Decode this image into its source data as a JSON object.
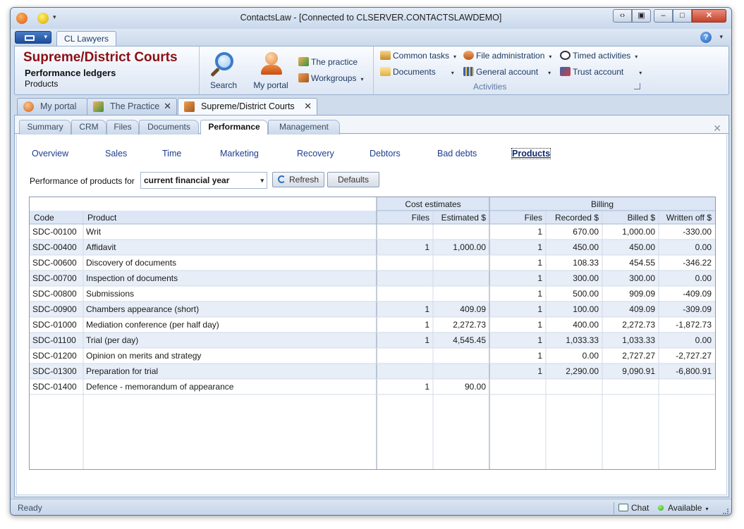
{
  "window": {
    "title": "ContactsLaw - [Connected to CLSERVER.CONTACTSLAWDEMO]",
    "ribbon_tab": "CL Lawyers"
  },
  "ribbon": {
    "context_title": "Supreme/District Courts",
    "context_subtitle": "Performance ledgers",
    "context_page": "Products",
    "search_label": "Search",
    "my_portal_label": "My portal",
    "the_practice_label": "The practice",
    "workgroups_label": "Workgroups",
    "common_tasks_label": "Common tasks",
    "documents_label": "Documents",
    "file_admin_label": "File administration",
    "general_account_label": "General account",
    "timed_activities_label": "Timed activities",
    "trust_account_label": "Trust account",
    "activities_group_label": "Activities"
  },
  "doc_tabs": [
    {
      "label": "My portal"
    },
    {
      "label": "The Practice"
    },
    {
      "label": "Supreme/District Courts"
    }
  ],
  "sub_tabs": [
    "Summary",
    "CRM",
    "Files",
    "Documents",
    "Performance",
    "Management"
  ],
  "nav_links": [
    "Overview",
    "Sales",
    "Time",
    "Marketing",
    "Recovery",
    "Debtors",
    "Bad debts",
    "Products"
  ],
  "filter": {
    "label": "Performance of products for",
    "period": "current financial year",
    "refresh_label": "Refresh",
    "defaults_label": "Defaults"
  },
  "table": {
    "group_headers": [
      "Cost estimates",
      "Billing"
    ],
    "columns": [
      "Code",
      "Product",
      "Files",
      "Estimated $",
      "Files",
      "Recorded $",
      "Billed $",
      "Written off $"
    ],
    "rows": [
      [
        "SDC-00100",
        "Writ",
        "",
        "",
        "1",
        "670.00",
        "1,000.00",
        "-330.00"
      ],
      [
        "SDC-00400",
        "Affidavit",
        "1",
        "1,000.00",
        "1",
        "450.00",
        "450.00",
        "0.00"
      ],
      [
        "SDC-00600",
        "Discovery of documents",
        "",
        "",
        "1",
        "108.33",
        "454.55",
        "-346.22"
      ],
      [
        "SDC-00700",
        "Inspection of documents",
        "",
        "",
        "1",
        "300.00",
        "300.00",
        "0.00"
      ],
      [
        "SDC-00800",
        "Submissions",
        "",
        "",
        "1",
        "500.00",
        "909.09",
        "-409.09"
      ],
      [
        "SDC-00900",
        "Chambers appearance (short)",
        "1",
        "409.09",
        "1",
        "100.00",
        "409.09",
        "-309.09"
      ],
      [
        "SDC-01000",
        "Mediation conference (per half day)",
        "1",
        "2,272.73",
        "1",
        "400.00",
        "2,272.73",
        "-1,872.73"
      ],
      [
        "SDC-01100",
        "Trial (per day)",
        "1",
        "4,545.45",
        "1",
        "1,033.33",
        "1,033.33",
        "0.00"
      ],
      [
        "SDC-01200",
        "Opinion on merits and strategy",
        "",
        "",
        "1",
        "0.00",
        "2,727.27",
        "-2,727.27"
      ],
      [
        "SDC-01300",
        "Preparation for trial",
        "",
        "",
        "1",
        "2,290.00",
        "9,090.91",
        "-6,800.91"
      ],
      [
        "SDC-01400",
        "Defence - memorandum of appearance",
        "1",
        "90.00",
        "",
        "",
        "",
        ""
      ]
    ]
  },
  "status": {
    "ready": "Ready",
    "chat": "Chat",
    "availability": "Available"
  }
}
